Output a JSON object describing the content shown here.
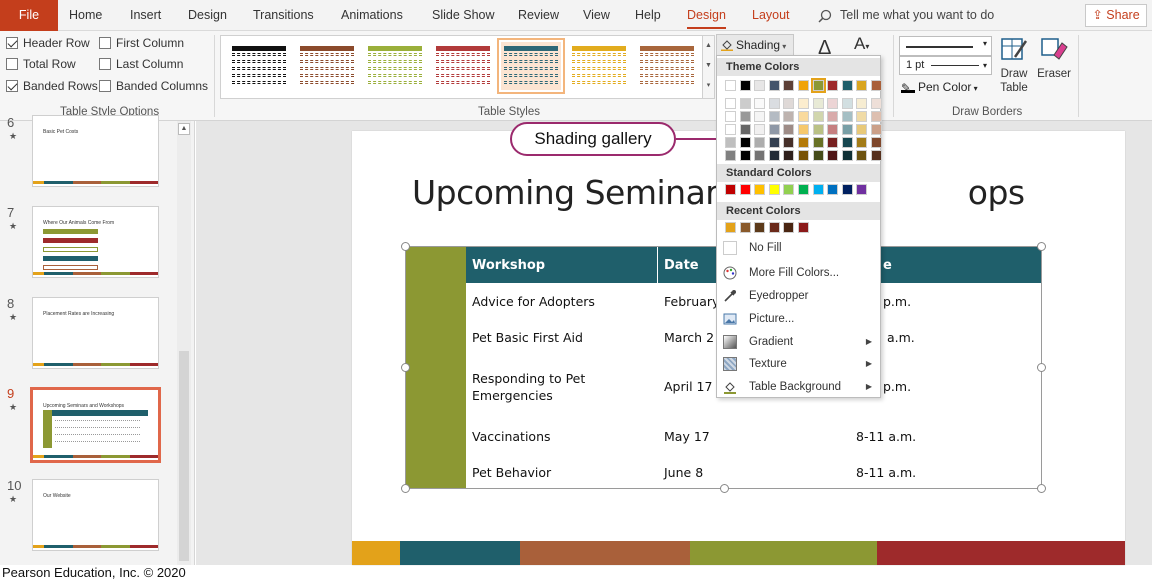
{
  "tabs": [
    {
      "label": "File"
    },
    {
      "label": "Home"
    },
    {
      "label": "Insert"
    },
    {
      "label": "Design"
    },
    {
      "label": "Transitions"
    },
    {
      "label": "Animations"
    },
    {
      "label": "Slide Show"
    },
    {
      "label": "Review"
    },
    {
      "label": "View"
    },
    {
      "label": "Help"
    },
    {
      "label": "Design"
    },
    {
      "label": "Layout"
    }
  ],
  "tell_me": "Tell me what you want to do",
  "share_label": "Share",
  "table_style_options": {
    "group_label": "Table Style Options",
    "checks": [
      {
        "label": "Header Row",
        "checked": true
      },
      {
        "label": "First Column",
        "checked": false
      },
      {
        "label": "Total Row",
        "checked": false
      },
      {
        "label": "Last Column",
        "checked": false
      },
      {
        "label": "Banded Rows",
        "checked": true
      },
      {
        "label": "Banded Columns",
        "checked": false
      }
    ]
  },
  "table_styles": {
    "group_label": "Table Styles",
    "style_colors": [
      "#111111",
      "#8b4a2b",
      "#9aaf3a",
      "#b23a3a",
      "#2e6777",
      "#e2ac1e",
      "#a8663c"
    ],
    "selected_index": 4
  },
  "shading_label": "Shading",
  "draw_borders": {
    "group_label": "Draw Borders",
    "weight": "1 pt",
    "pen_color": "Pen Color",
    "draw_table": "Draw Table",
    "eraser": "Eraser"
  },
  "slides": [
    {
      "num": "6",
      "title": "Basic Pet Costs"
    },
    {
      "num": "7",
      "title": "Where Our Animals Come From"
    },
    {
      "num": "8",
      "title": "Placement Rates are Increasing"
    },
    {
      "num": "9",
      "title": "Upcoming Seminars and Workshops"
    },
    {
      "num": "10",
      "title": "Our Website"
    }
  ],
  "slide_title": "Upcoming Seminars a",
  "slide_title_tail": "ops",
  "table": {
    "headers": [
      "Workshop",
      "Date",
      "e"
    ],
    "rows": [
      [
        "Advice for Adopters",
        "February",
        "p.m."
      ],
      [
        "Pet Basic First Aid",
        "March 2",
        "a.m."
      ],
      [
        "Responding to Pet",
        "Emergencies",
        "April 17",
        "p.m."
      ],
      [
        "Vaccinations",
        "May 17",
        "8-11 a.m."
      ],
      [
        "Pet Behavior",
        "June 8",
        "8-11 a.m."
      ]
    ]
  },
  "callout": "Shading gallery",
  "shading_menu": {
    "theme_colors_label": "Theme Colors",
    "standard_colors_label": "Standard Colors",
    "recent_colors_label": "Recent Colors",
    "theme_top": [
      "#ffffff",
      "#000000",
      "#e7e6e6",
      "#44546a",
      "#5d4037",
      "#f0a30a",
      "#8c9833",
      "#9e2a2b",
      "#1f5f6b",
      "#d9a520",
      "#a9603a"
    ],
    "standard": [
      "#c00000",
      "#ff0000",
      "#ffc000",
      "#ffff00",
      "#92d050",
      "#00b050",
      "#00b0f0",
      "#0070c0",
      "#002060",
      "#7030a0"
    ],
    "recent": [
      "#e3a21a",
      "#8a5a2b",
      "#5c3a1a",
      "#6b2a1a",
      "#4a2511",
      "#8b1a1a"
    ],
    "items": [
      {
        "label": "No Fill",
        "icon": "no-fill-icon"
      },
      {
        "label": "More Fill Colors...",
        "icon": "palette-icon"
      },
      {
        "label": "Eyedropper",
        "icon": "eyedropper-icon"
      },
      {
        "label": "Picture...",
        "icon": "picture-icon"
      },
      {
        "label": "Gradient",
        "icon": "gradient-icon",
        "submenu": true
      },
      {
        "label": "Texture",
        "icon": "texture-icon",
        "submenu": true
      },
      {
        "label": "Table Background",
        "icon": "paint-bucket-icon",
        "submenu": true
      }
    ]
  },
  "credit": "Pearson Education, Inc. © 2020"
}
